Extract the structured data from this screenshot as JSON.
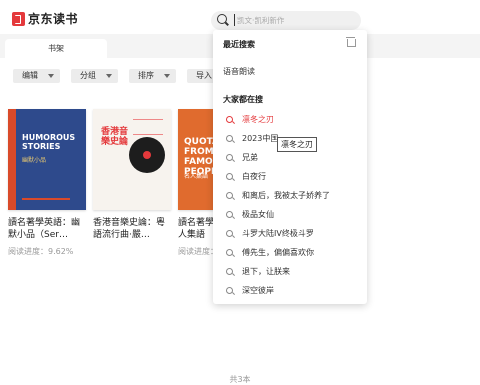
{
  "app": {
    "logo_text": "京东读书"
  },
  "search": {
    "placeholder": "凯文·凯利新作"
  },
  "tabs": {
    "shelf": "书架"
  },
  "toolbar": {
    "edit": "编辑",
    "group": "分组",
    "sort": "排序",
    "import": "导入"
  },
  "books": [
    {
      "cover_title": "HUMOROUS STORIES",
      "cover_sub": "幽默小品",
      "title": "讀名著學英語：幽默小品（Ser…",
      "progress": "阅读进度：9.62%"
    },
    {
      "cover_title": "香港音樂史論",
      "title": "香港音樂史論：粵語流行曲·嚴…",
      "progress": ""
    },
    {
      "cover_title": "QUOTATIONS FROM FAMOUS PEOPLE",
      "cover_sub": "名人集語",
      "title": "讀名著學英語：名人集語",
      "progress": "阅读进度："
    }
  ],
  "footer": {
    "count": "共3本"
  },
  "dropdown": {
    "recent_heading": "最近搜索",
    "recent": [
      "语音朗读"
    ],
    "hot_heading": "大家都在搜",
    "hot": [
      "凛冬之刃",
      "2023中国",
      "兄弟",
      "白夜行",
      "和离后，我被太子娇养了",
      "极品女仙",
      "斗罗大陆IV终极斗罗",
      "傅先生，偏偏喜欢你",
      "退下，让朕来",
      "深空彼岸"
    ]
  },
  "tooltip": "凛冬之刃",
  "colors": {
    "accent": "#e4393c"
  }
}
